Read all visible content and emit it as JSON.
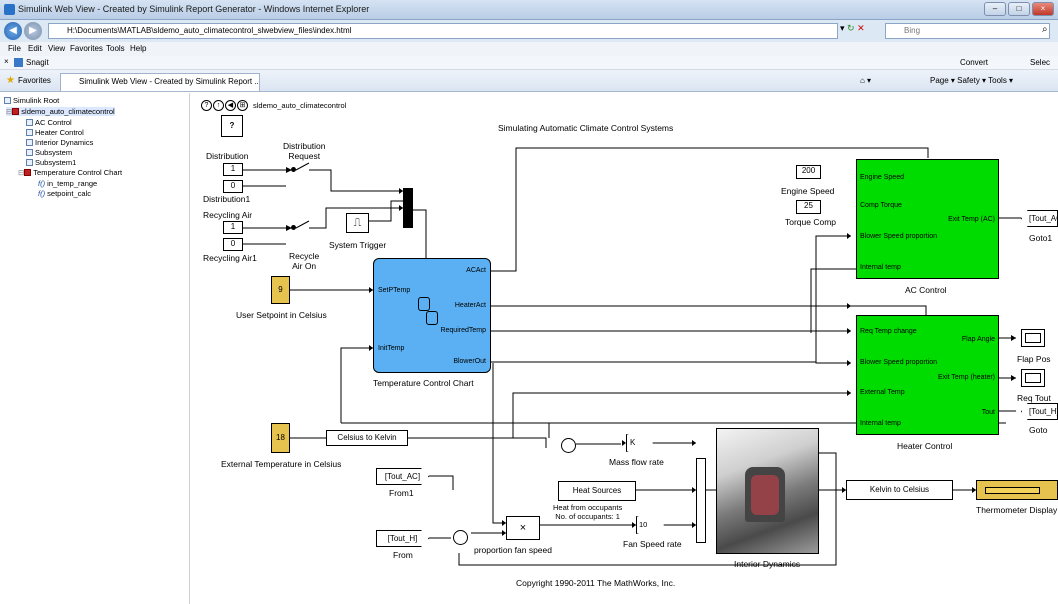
{
  "window": {
    "title": "Simulink Web View - Created by Simulink Report Generator - Windows Internet Explorer",
    "address": "H:\\Documents\\MATLAB\\sldemo_auto_climatecontrol_slwebview_files\\index.html",
    "search_placeholder": "Bing"
  },
  "menu": [
    "File",
    "Edit",
    "View",
    "Favorites",
    "Tools",
    "Help"
  ],
  "links": {
    "snagit": "Snagit",
    "convert": "Convert",
    "select": "Selec"
  },
  "favorites": {
    "label": "Favorites",
    "tab": "Simulink Web View - Created by Simulink Report ...",
    "right_cmds": "Page ▾  Safety ▾  Tools ▾"
  },
  "tree": {
    "root": "Simulink Root",
    "model": "sldemo_auto_climatecontrol",
    "items": [
      "AC Control",
      "Heater Control",
      "Interior Dynamics",
      "Subsystem",
      "Subsystem1",
      "Temperature Control Chart",
      "in_temp_range",
      "setpoint_calc"
    ]
  },
  "canvas": {
    "model_name": "sldemo_auto_climatecontrol",
    "help": "?",
    "title": "Simulating Automatic Climate Control Systems",
    "copyright": "Copyright 1990-2011 The MathWorks, Inc.",
    "distribution": {
      "label": "Distribution",
      "c1": "1",
      "c0": "0",
      "c0_label": "Distribution1",
      "switch_label": "Distribution\nRequest"
    },
    "recycling": {
      "label": "Recycling Air",
      "c1": "1",
      "c0": "0",
      "c0_label": "Recycling Air1",
      "switch_label": "Recycle\nAir On"
    },
    "system_trigger": "System Trigger",
    "user_setpoint": {
      "value": "9",
      "label": "User Setpoint in Celsius"
    },
    "ext_temp": {
      "value": "18",
      "label": "External Temperature in Celsius"
    },
    "chart": {
      "label": "Temperature Control Chart",
      "in1": "SetPTemp",
      "in2": "InitTemp",
      "out1": "ACAct",
      "out2": "HeaterAct",
      "out3": "RequiredTemp",
      "out4": "BlowerOut"
    },
    "ac": {
      "label": "AC Control",
      "engine_speed_value": "200",
      "engine_speed_label": "Engine Speed",
      "torque_value": "25",
      "torque_label": "Torque Comp",
      "in1": "Engine Speed",
      "in2": "Comp Torque",
      "in3": "Blower Speed proportion",
      "in4": "Internal temp",
      "out1": "Exit Temp (AC)",
      "goto": "[Tout_AC]",
      "goto_label": "Goto1"
    },
    "heater": {
      "label": "Heater Control",
      "in1": "Req Temp change",
      "in2": "Blower Speed proportion",
      "in3": "External Temp",
      "in4": "Internal temp",
      "out1": "Flap Angle",
      "out2": "Exit Temp (heater)",
      "out3": "Tout",
      "goto": "[Tout_H]",
      "goto_label": "Goto"
    },
    "scopes": {
      "flap": "Flap Pos",
      "req": "Req Tout"
    },
    "c2k": "Celsius to Kelvin",
    "mass_flow": {
      "label": "Mass flow rate",
      "gain": "K"
    },
    "heat_sources": {
      "label": "Heat Sources",
      "caption": "Heat from occupants\nNo. of occupants: 1"
    },
    "from_ac": {
      "label": "[Tout_AC]",
      "caption": "From1"
    },
    "from_h": {
      "label": "[Tout_H]",
      "caption": "From"
    },
    "product": {
      "label": "proportion fan speed",
      "sym": "×"
    },
    "fan_gain": {
      "label": "Fan Speed rate",
      "value": "10"
    },
    "interior": "Interior Dynamics",
    "k2c": "Kelvin to Celsius",
    "thermo": "Thermometer Display"
  }
}
